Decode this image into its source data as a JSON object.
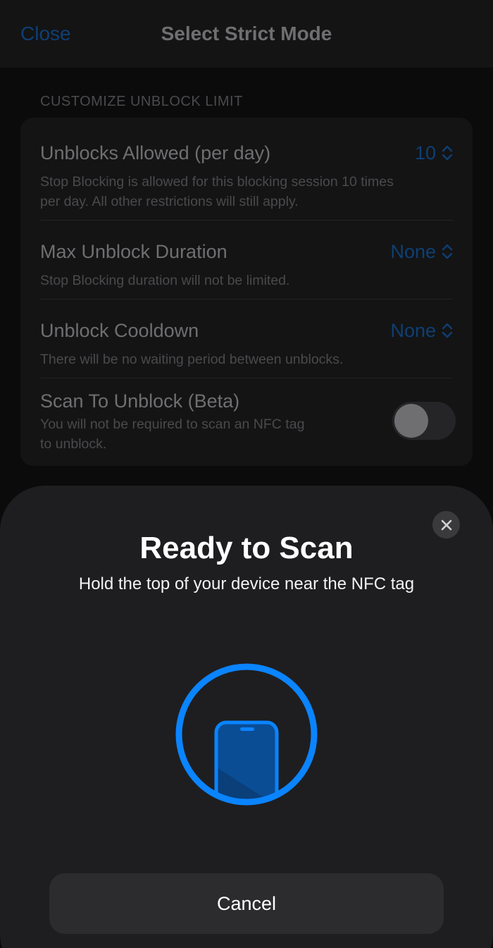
{
  "nav": {
    "close_label": "Close",
    "title": "Select Strict Mode"
  },
  "section": {
    "header": "CUSTOMIZE UNBLOCK LIMIT"
  },
  "settings": {
    "unblocks_allowed": {
      "title": "Unblocks Allowed (per day)",
      "value": "10",
      "subtitle_line1": "Stop Blocking is allowed for this blocking session 10 times",
      "subtitle_line2": "per day. All other restrictions will still apply."
    },
    "max_duration": {
      "title": "Max Unblock Duration",
      "value": "None",
      "subtitle": "Stop Blocking duration will not be limited."
    },
    "cooldown": {
      "title": "Unblock Cooldown",
      "value": "None",
      "subtitle": "There will be no waiting period between unblocks."
    },
    "scan_to_unblock": {
      "title": "Scan To Unblock (Beta)",
      "subtitle_line1": "You will not be required to scan an NFC tag",
      "subtitle_line2": "to unblock.",
      "enabled": false
    }
  },
  "nfc_sheet": {
    "title": "Ready to Scan",
    "subtitle": "Hold the top of your device near the NFC tag",
    "cancel_label": "Cancel",
    "close_icon": "xmark-icon",
    "graphic_icon": "phone-nfc-icon"
  },
  "colors": {
    "accent_blue": "#0a84ff",
    "sheet_bg": "#1e1e20",
    "button_bg": "#2c2c2e"
  }
}
